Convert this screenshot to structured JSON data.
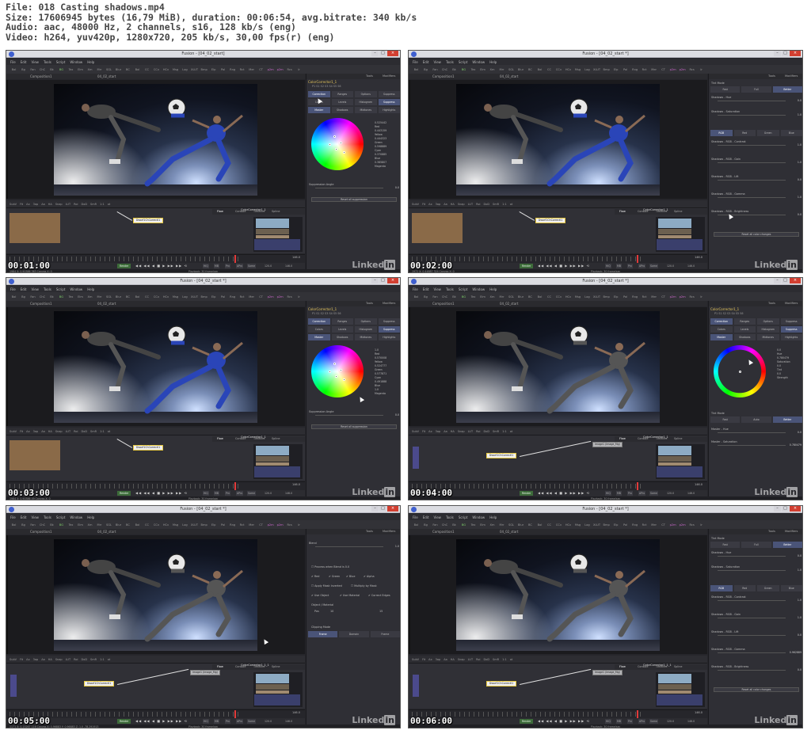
{
  "header": {
    "line1": "File: 018 Casting shadows.mp4",
    "line2": "Size: 17606945 bytes (16,79 MiB), duration: 00:06:54, avg.bitrate: 340 kb/s",
    "line3": "Audio: aac, 48000 Hz, 2 channels, s16, 128 kb/s (eng)",
    "line4": "Video: h264, yuv420p, 1280x720, 205 kb/s, 30,00 fps(r) (eng)"
  },
  "app": {
    "menu": [
      "File",
      "Edit",
      "View",
      "Tools",
      "Script",
      "Window",
      "Help"
    ],
    "toolbar": [
      "Bol",
      "Bg",
      "Fan",
      "ChC",
      "Bk",
      "BG",
      "Tex",
      "Elm",
      "Xm",
      "Mrr",
      "SGL",
      "Blur",
      "BC",
      "Bol",
      "CC",
      "CCv",
      "HCv",
      "Msg",
      "Log",
      "XLUT",
      "Bmp",
      "Elp",
      "Pol",
      "Rng",
      "Rct",
      "Mer",
      "CT",
      "p2m",
      "p2m",
      "Rcs",
      "Ir"
    ],
    "panel_tabs": {
      "tools": "Tools",
      "modifiers": "Modifiers"
    },
    "viewer_tab": "Composition1",
    "viewer_tab2": "04_02_start",
    "viewbar": [
      "SubV",
      "Fit",
      "Ax",
      "3ap",
      "Aa",
      "HA",
      "Snap",
      "LUT",
      "Roi",
      "DoD",
      "SmR",
      "1:1",
      "ot"
    ],
    "node_tabs": [
      "Flow",
      "Console",
      "Timeline",
      "Spline"
    ],
    "render_label": "Render",
    "hq": [
      "HiQ",
      "MB",
      "Prx",
      "APrx",
      "Some"
    ],
    "transport_glyphs": "◀◀ ◀◀ ◀ ■ ▶ ▶▶ ▶▶ ⟲",
    "fps_label": "Playback: 30 frame/sec",
    "time_left": "0.0",
    "time_right_a": "146.0",
    "time_right_b": "120.0",
    "time_in": "60.0",
    "linkedin_text": "Linked",
    "linkedin_badge": "in"
  },
  "frames": [
    {
      "timestamp": "00:01:00",
      "title": "Fusion - [04_02_start]",
      "node_name": "ColorCorrector1_1",
      "node_tile": "Dwarf1ChCorrectl1",
      "inspector_title": "ColorCorrector1_1",
      "insp_icons": "P1 S1 S2 S3 S4 S5 S6",
      "seg1": [
        "Correction",
        "Ranges",
        "Options",
        "Suppress"
      ],
      "seg2": [
        "Colors",
        "Levels",
        "Histogram",
        "Suppress"
      ],
      "seg3": [
        "Master",
        "Shadows",
        "Midtones",
        "Highlights"
      ],
      "wheel_vals": [
        "0.525442",
        "Red",
        "0.443159",
        "Yellow",
        "0.444323",
        "Green",
        "0.598889",
        "Cyan",
        "0.370885",
        "Blue",
        "0.385807",
        "Magenta"
      ],
      "bottom_label": "Suppression Angle",
      "bottom_value": "0.0",
      "button": "Reset all suppression",
      "status": "1984  X: 0.90386  363   Canvas  X: 0"
    },
    {
      "timestamp": "00:02:00",
      "title": "Fusion - [04_02_start *]",
      "node_name": "ColorCorrector1_1",
      "node_tile": "Dwarf1ChCorrectl1",
      "tint_label": "Tint Mode",
      "tint": [
        "Fast",
        "Full",
        "Better"
      ],
      "params": [
        {
          "label": "Shadows - Hue",
          "value": "0.0"
        },
        {
          "label": "Shadows - Saturation",
          "value": "1.0"
        }
      ],
      "rgbtabs": [
        "RGB",
        "Red",
        "Green",
        "Blue"
      ],
      "params2": [
        {
          "label": "Shadows - RGB - Contrast",
          "value": "1.0"
        },
        {
          "label": "Shadows - RGB - Gain",
          "value": "1.0"
        },
        {
          "label": "Shadows - RGB - Lift",
          "value": "0.0"
        },
        {
          "label": "Shadows - RGB - Gamma",
          "value": "1.0"
        },
        {
          "label": "Shadows - RGB - Brightness",
          "value": "0.0"
        }
      ],
      "button": "Reset all color changes",
      "status": "1972  X: 0.44887  324   Canvas  X: 0"
    },
    {
      "timestamp": "00:03:00",
      "title": "Fusion - [04_02_start *]",
      "node_name": "ColorCorrector1_1",
      "node_tile": "Dwarf1ChCorrectl1",
      "inspector_title": "ColorCorrector1_1",
      "insp_icons": "P1 S1 S2 S3 S4 S5 S6",
      "seg1": [
        "Correction",
        "Ranges",
        "Options",
        "Suppress"
      ],
      "seg2": [
        "Colors",
        "Levels",
        "Histogram",
        "Suppress"
      ],
      "seg3": [
        "Master",
        "Shadows",
        "Midtones",
        "Highlights"
      ],
      "wheel_vals": [
        "1.0",
        "Red",
        "0.570008",
        "Yellow",
        "0.524777",
        "Green",
        "0.577871",
        "Cyan",
        "0.491888",
        "Blue",
        "1.0",
        "Magenta"
      ],
      "bottom_label": "Suppression Angle",
      "bottom_value": "0.0",
      "button": "Reset all suppression",
      "status": "1984  X: 0.90386  49   Canvas  X: 0"
    },
    {
      "timestamp": "00:04:00",
      "title": "Fusion - [04_02_start *]",
      "node_name": "ColorCorrector1_1",
      "node_tile": "Dwarf1ChCorrectl1",
      "node_tile2": "Image1 (Image_Mg)",
      "inspector_title": "ColorCorrector1_1",
      "insp_icons": "P1 S1 S2 S3 S4 S5 S6",
      "seg1": [
        "Correction",
        "Ranges",
        "Options",
        "Suppress"
      ],
      "seg2": [
        "Colors",
        "Levels",
        "Histogram",
        "Suppress"
      ],
      "seg3": [
        "Master",
        "Shadows",
        "Midtones",
        "Highlights"
      ],
      "wheel_vals": [
        "0.0",
        "Hue",
        "0.780479",
        "Saturation",
        "0.0",
        "Tint",
        "0.0",
        "Strength"
      ],
      "tint_label": "Tint Mode",
      "tint": [
        "Fast",
        "Auto",
        "Better"
      ],
      "params": [
        {
          "label": "Master - Hue",
          "value": "0.0"
        },
        {
          "label": "Master - Saturation",
          "value": "0.780479"
        }
      ],
      "status": ""
    },
    {
      "timestamp": "00:05:00",
      "title": "Fusion - [04_02_start *]",
      "node_name": "ColorCorrector1_1_1",
      "node_tile": "Dwarf1ChCorrectl1",
      "node_tile2": "Image1 (Image_Mg)",
      "blend_label": "Blend",
      "blend_value": "1.0",
      "process": "Process when Blend is 0.0",
      "checks": [
        "Red",
        "Green",
        "Blue",
        "Alpha"
      ],
      "checks2": [
        "Apply Mask Inverted",
        "Multiply by Mask"
      ],
      "checks3": [
        "Use Object",
        "Use Material",
        "Correct Edges"
      ],
      "obj_label": "Object / Material",
      "pos_label": "Pos",
      "pos_vals": [
        "10",
        "15"
      ],
      "clip_label": "Clipping Mode",
      "clip": [
        "Frame",
        "Domain",
        "Frame"
      ],
      "status": "1171  X: 0.15267  116   Canvas  X: 0.96883  Y: 0.96883  Z: 1.0   -78.291913"
    },
    {
      "timestamp": "00:06:00",
      "title": "Fusion - [04_02_start *]",
      "node_name": "ColorCorrector1_1_1",
      "node_tile": "Dwarf1ChCorrectl1",
      "node_tile2": "Image1 (Image_Mg)",
      "tint_label": "Tint Mode",
      "tint": [
        "Fast",
        "Full",
        "Better"
      ],
      "params": [
        {
          "label": "Shadows - Hue",
          "value": "0.0"
        },
        {
          "label": "Shadows - Saturation",
          "value": "1.0"
        }
      ],
      "rgbtabs": [
        "RGB",
        "Red",
        "Green",
        "Blue"
      ],
      "params2": [
        {
          "label": "Shadows - RGB - Contrast",
          "value": "1.0"
        },
        {
          "label": "Shadows - RGB - Gain",
          "value": "1.0"
        },
        {
          "label": "Shadows - RGB - Lift",
          "value": "0.0"
        },
        {
          "label": "Shadows - RGB - Gamma",
          "value": "0.962889"
        },
        {
          "label": "Shadows - RGB - Brightness",
          "value": "0.0"
        }
      ],
      "button": "Reset all color changes",
      "status": ""
    }
  ]
}
